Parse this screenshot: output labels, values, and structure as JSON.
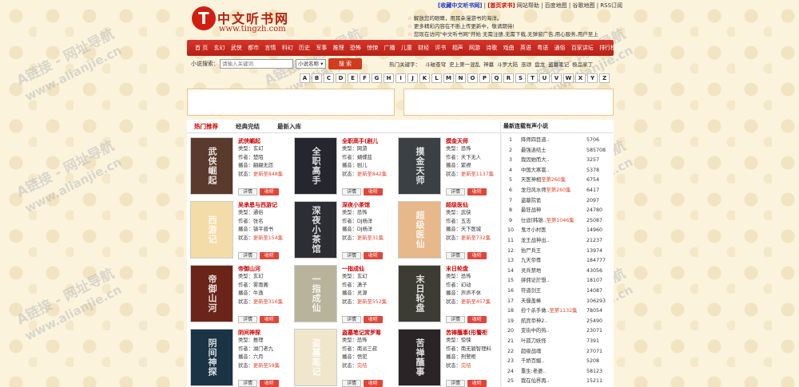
{
  "toplinks": {
    "bookmark": "[收藏中文听书网]",
    "separator": "|",
    "ad_cooperation": "[首页求书]",
    "links": "网站帮助 | 百度地图 | 谷歌地图 | RSS订阅"
  },
  "logo": {
    "emblem": "T",
    "title": "中文听书网",
    "url": "www.tingzh.com"
  },
  "notices": [
    "解放您的眼睛，用耳朵漫游书的海洋。",
    "更多精彩内容在不断上传更新中，敬请期待!",
    "您现在访问\"中文听书网\"开始 无需注册,无需下载,无弹窗广告,用心服务,用户至上"
  ],
  "nav": [
    "首 页",
    "玄幻",
    "武侠",
    "都市",
    "言情",
    "科幻",
    "历史",
    "军事",
    "推理",
    "恐怖",
    "惊悚",
    "广播",
    "儿童",
    "财经",
    "评书",
    "相声",
    "网游",
    "诗歌",
    "戏曲",
    "英语",
    "粤语",
    "通俗",
    "百家讲坛",
    "排行榜"
  ],
  "search": {
    "label": "小说搜索：",
    "placeholder": "请输入关键词",
    "select_value": "小说名称",
    "button": "搜 索",
    "hot_label": "热门关键字：",
    "hot_keywords": [
      "斗破苍穹",
      "史上第一混乱",
      "神墓",
      "斗罗大陆",
      "巫颂",
      "盘龙",
      "盗墓笔记",
      "极品家丁"
    ]
  },
  "alphabet": [
    "A",
    "B",
    "C",
    "D",
    "E",
    "F",
    "G",
    "H",
    "I",
    "J",
    "K",
    "L",
    "M",
    "N",
    "O",
    "P",
    "Q",
    "R",
    "S",
    "T",
    "U",
    "V",
    "W",
    "X",
    "Y",
    "Z"
  ],
  "tabs": [
    "热门推荐",
    "经典完结",
    "最新入库"
  ],
  "book_field_labels": {
    "type": "类型：",
    "author": "作者：",
    "narrator": "播音：",
    "status": "状态："
  },
  "book_buttons": {
    "detail": "详情",
    "listen": "收听"
  },
  "books": [
    {
      "title": "武侠崛起",
      "type": "玄幻",
      "author": "楚陌",
      "narrator": "翩翩无怨",
      "status": "更新至848集",
      "cover_text": "武侠崛起",
      "cover_color": "#5a3a2c"
    },
    {
      "title": "全职高手(剧儿",
      "type": "网游",
      "author": "蝴蝶蓝",
      "narrator": "剧儿",
      "status": "更新至842集",
      "cover_text": "全职高手",
      "cover_color": "#26262e"
    },
    {
      "title": "摸金天师",
      "type": "恐怖",
      "author": "天下无人",
      "narrator": "紫襟",
      "status": "更新至1137集",
      "cover_text": "摸金天师",
      "cover_color": "#3a4043"
    },
    {
      "title": "吴承恩与西游记",
      "type": "通俗",
      "author": "张名",
      "narrator": "镇平晋书",
      "status": "更新至154集",
      "cover_text": "西游记",
      "cover_color": "#f4dca8"
    },
    {
      "title": "深夜小茶馆",
      "type": "恐怖",
      "author": "DJ杨洋",
      "narrator": "DJ杨洋",
      "status": "更新至31集",
      "cover_text": "深夜小茶馆",
      "cover_color": "#2c2e34"
    },
    {
      "title": "超级医仙",
      "type": "武侠",
      "author": "五志",
      "narrator": "天下医城",
      "status": "更新至732集",
      "cover_text": "超级医仙",
      "cover_color": "#e6b88a"
    },
    {
      "title": "帝御山河",
      "type": "玄幻",
      "author": "雾雨阁",
      "narrator": "牛逸",
      "status": "更新至316集",
      "cover_text": "帝御山河",
      "cover_color": "#6a2418"
    },
    {
      "title": "一指成仙",
      "type": "玄幻",
      "author": "潇子",
      "narrator": "灵源",
      "status": "更新至552集",
      "cover_text": "一指成仙",
      "cover_color": "#b8b49c"
    },
    {
      "title": "末日轮盘",
      "type": "恐怖",
      "author": "幻动",
      "narrator": "声声不休",
      "status": "更新至457集",
      "cover_text": "末日轮盘",
      "cover_color": "#3c3c34"
    },
    {
      "title": "阴间神探",
      "type": "推理",
      "author": "湖门老九",
      "narrator": "六月",
      "status": "更新至58集",
      "cover_text": "阴间神探",
      "cover_color": "#1a3446"
    },
    {
      "title": "盗墓笔记赏罗筹",
      "type": "恐怖",
      "author": "南派三叔",
      "narrator": "悟犯",
      "status": "完结",
      "cover_text": "盗墓笔记",
      "cover_color": "#efe6cc"
    },
    {
      "title": "苦禅蘸事(形警柜",
      "type": "惊悚",
      "author": "南无颖智理料",
      "narrator": "刑警柜",
      "status": "完结",
      "cover_text": "苦禅蘸事",
      "cover_color": "#2a2426"
    }
  ],
  "sidebar": {
    "title": "最新连载有声小说",
    "rows": [
      {
        "num": "1",
        "title": "降师四目道..",
        "highlight": "",
        "count": "5706"
      },
      {
        "num": "2",
        "title": "最强逍结土",
        "highlight": "",
        "count": "585708"
      },
      {
        "num": "3",
        "title": "我因她而大..",
        "highlight": "",
        "count": "3257"
      },
      {
        "num": "4",
        "title": "中国大寒寰..",
        "highlight": "",
        "count": "5378"
      },
      {
        "num": "5",
        "title": "天医神相",
        "highlight": "至第260集",
        "count": "6754"
      },
      {
        "num": "6",
        "title": "龙归风水师",
        "highlight": "至第260集",
        "count": "6417"
      },
      {
        "num": "7",
        "title": "盗墓院诡",
        "highlight": "",
        "count": "2097"
      },
      {
        "num": "8",
        "title": "最狂战神",
        "highlight": "",
        "count": "24780"
      },
      {
        "num": "9",
        "title": "仕途[韩雄..",
        "highlight": "至第1046集",
        "count": "25087"
      },
      {
        "num": "10",
        "title": "鬼才小村医",
        "highlight": "",
        "count": "14960"
      },
      {
        "num": "11",
        "title": "龙王战神出..",
        "highlight": "",
        "count": "21237"
      },
      {
        "num": "12",
        "title": "抬尸兵王",
        "highlight": "",
        "count": "13974"
      },
      {
        "num": "13",
        "title": "九天帝尊",
        "highlight": "",
        "count": "184777"
      },
      {
        "num": "14",
        "title": "灵兵禁地",
        "highlight": "",
        "count": "43056"
      },
      {
        "num": "15",
        "title": "拼佣证於想..",
        "highlight": "",
        "count": "18107"
      },
      {
        "num": "16",
        "title": "符道剑王",
        "highlight": "",
        "count": "14087"
      },
      {
        "num": "17",
        "title": "天僵盖棒",
        "highlight": "",
        "count": "106293"
      },
      {
        "num": "18",
        "title": "捡个杀手做..",
        "highlight": "至第1132集",
        "count": "78054"
      },
      {
        "num": "19",
        "title": "航宾帝神2..",
        "highlight": "",
        "count": "25490"
      },
      {
        "num": "20",
        "title": "变街中的热..",
        "highlight": "",
        "count": "23071"
      },
      {
        "num": "21",
        "title": "叶孤刀妖怪",
        "highlight": "",
        "count": "7391"
      },
      {
        "num": "22",
        "title": "超级战魂",
        "highlight": "",
        "count": "27071"
      },
      {
        "num": "23",
        "title": "千娇百媚..",
        "highlight": "",
        "count": "5208"
      },
      {
        "num": "24",
        "title": "重生:老婆..",
        "highlight": "",
        "count": "58123"
      },
      {
        "num": "25",
        "title": "我在仙界再..",
        "highlight": "",
        "count": "15211"
      }
    ]
  },
  "watermark": {
    "text": "A链接 - 网址导航",
    "url": "www.alianjie.cn"
  }
}
